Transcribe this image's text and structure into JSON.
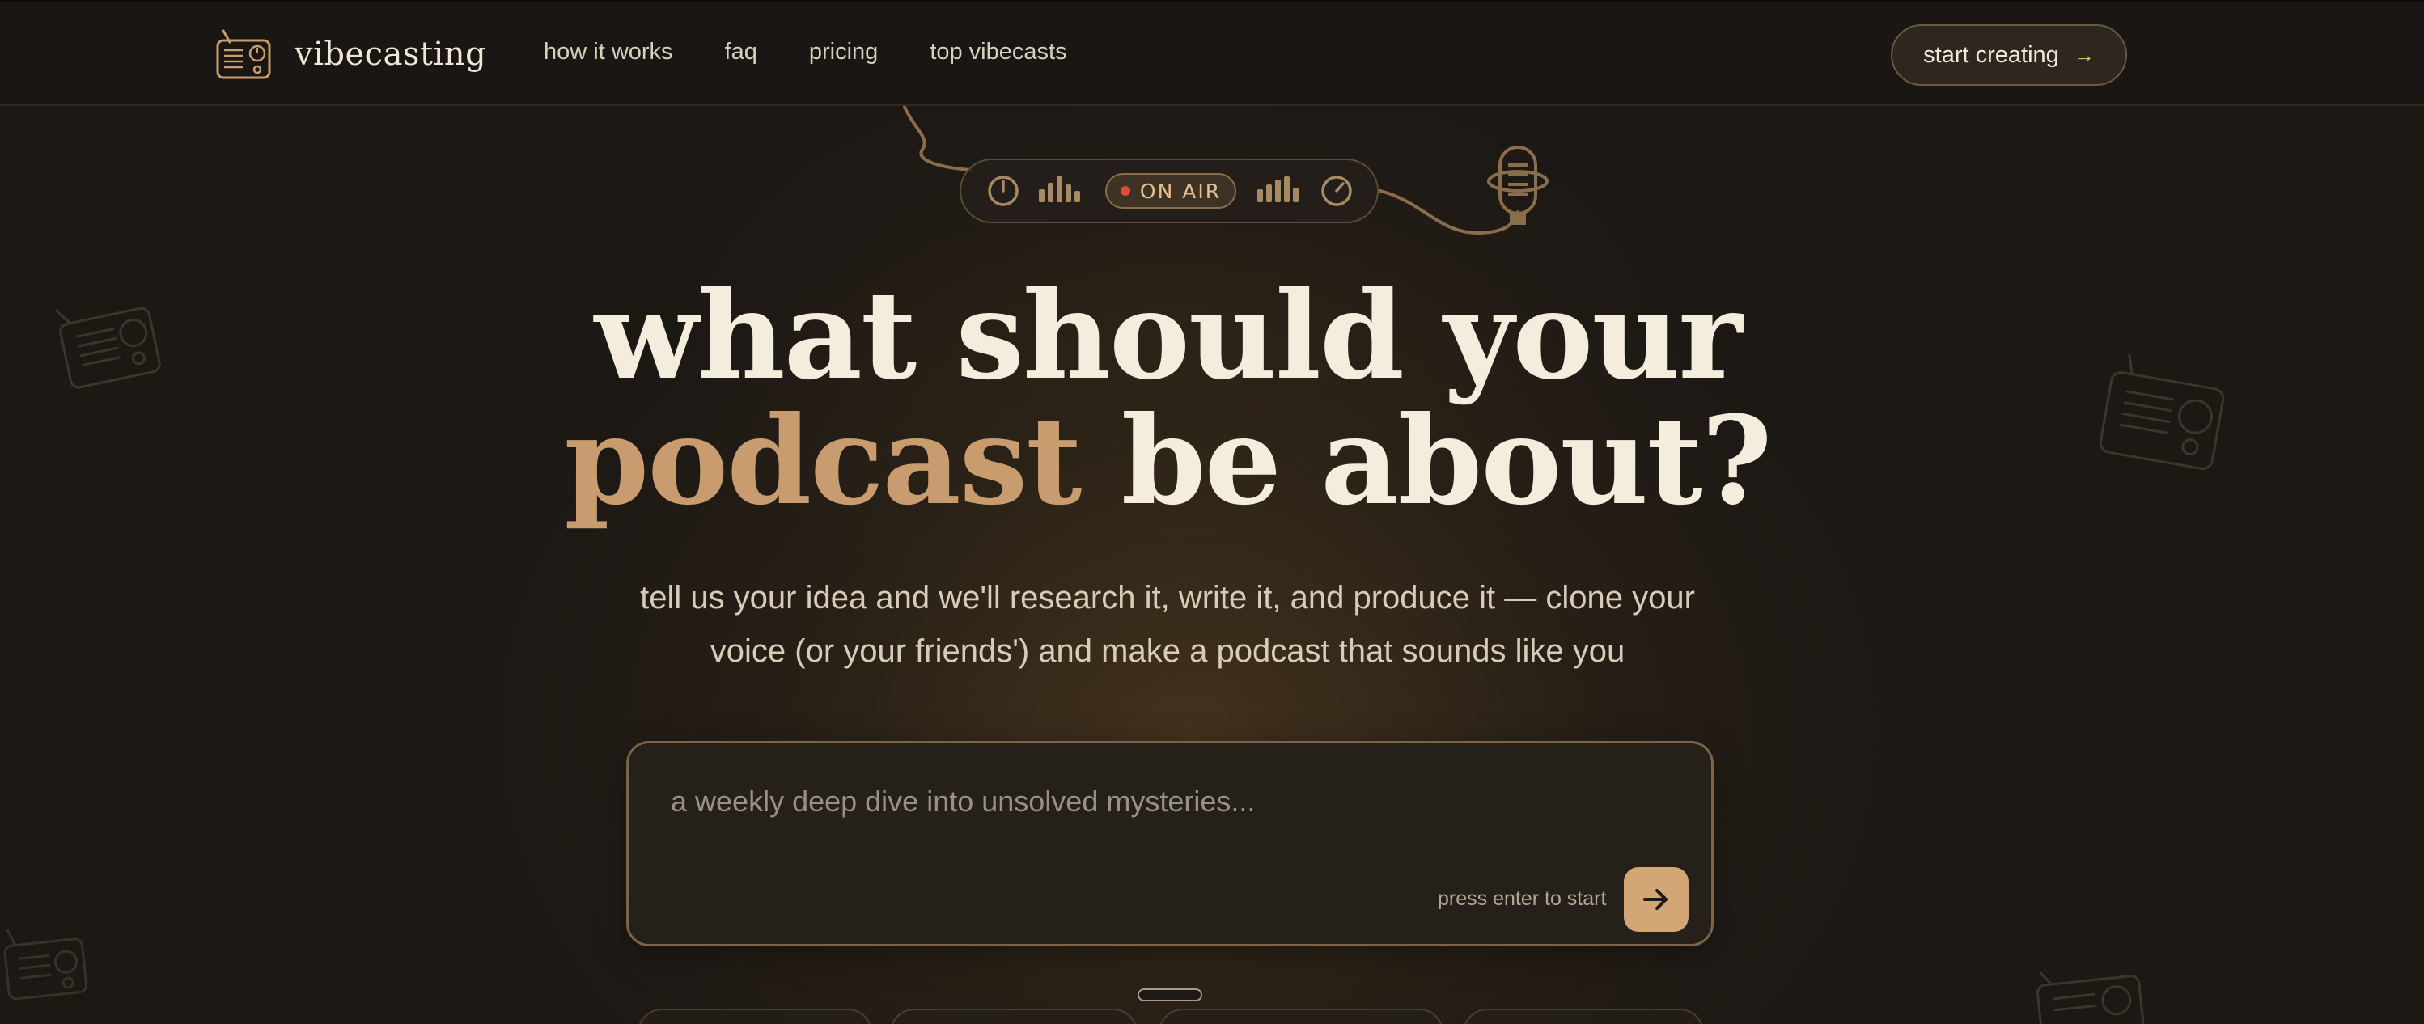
{
  "brand": {
    "name": "vibecasting",
    "logo_icon": "radio-icon"
  },
  "nav": {
    "links": [
      {
        "label": "how it works"
      },
      {
        "label": "faq"
      },
      {
        "label": "pricing"
      },
      {
        "label": "top vibecasts"
      }
    ],
    "cta_label": "start creating",
    "cta_arrow": "→"
  },
  "onair": {
    "label": "ON AIR",
    "left_icons": [
      "power-knob-icon",
      "level-bars-icon"
    ],
    "right_icons": [
      "level-bars-icon",
      "dial-knob-icon"
    ],
    "mic_icon": "microphone-icon",
    "indicator_color": "#e04b3a"
  },
  "hero": {
    "line1": "what should your",
    "accent": "podcast",
    "line2_rest": " be about?",
    "subtitle_line1": "tell us your idea and we'll research it, write it, and produce it — clone your",
    "subtitle_line2": "voice (or your friends') and make a podcast that sounds like you"
  },
  "prompt": {
    "placeholder": "a weekly deep dive into unsolved mysteries...",
    "value": "",
    "hint": "press enter to start",
    "submit_icon": "arrow-right-icon"
  },
  "colors": {
    "background": "#1c1814",
    "accent": "#c89c6e",
    "button": "#d4a676",
    "text": "#f4ecdd"
  }
}
